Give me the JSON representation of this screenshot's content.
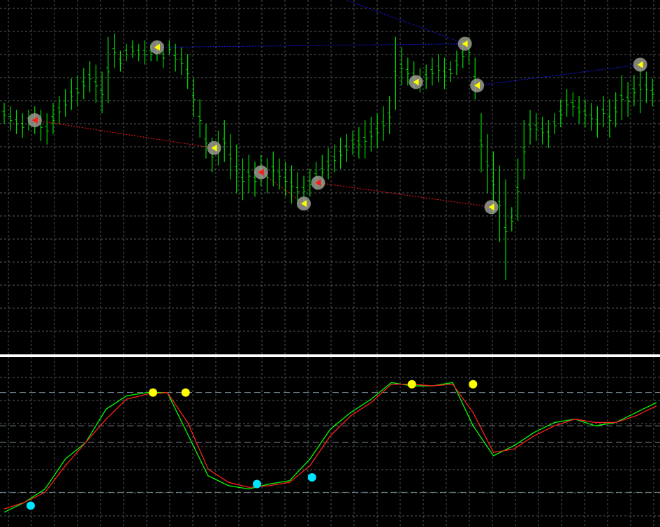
{
  "colors": {
    "background": "#000000",
    "grid": "#9aa3a3",
    "candle": "#00dd00",
    "upper_trend": "#1a1aff",
    "lower_trend": "#ff1a1a",
    "signal_marker": "#9a9a90",
    "osc_main": "#00ff00",
    "osc_signal": "#ff2020",
    "dot_top": "#ffff00",
    "dot_bottom": "#00e5ff",
    "level_line": "#7a8a95",
    "separator": "#ffffff"
  },
  "chart_data": [
    {
      "type": "ohlc",
      "panel": "price",
      "xlim": [
        0,
        320
      ],
      "ylim": [
        0,
        100
      ],
      "grid": true,
      "bars": [
        [
          0,
          72,
          66
        ],
        [
          3,
          71,
          64
        ],
        [
          6,
          70,
          63
        ],
        [
          9,
          69,
          62
        ],
        [
          12,
          70,
          64
        ],
        [
          15,
          71,
          63
        ],
        [
          18,
          70,
          61
        ],
        [
          21,
          69,
          60
        ],
        [
          24,
          72,
          63
        ],
        [
          27,
          74,
          66
        ],
        [
          30,
          76,
          68
        ],
        [
          33,
          79,
          70
        ],
        [
          36,
          80,
          71
        ],
        [
          39,
          82,
          73
        ],
        [
          42,
          84,
          75
        ],
        [
          45,
          83,
          72
        ],
        [
          48,
          81,
          69
        ],
        [
          51,
          91,
          72
        ],
        [
          54,
          92,
          82
        ],
        [
          57,
          87,
          81
        ],
        [
          60,
          89,
          84
        ],
        [
          63,
          90,
          85
        ],
        [
          66,
          89,
          84
        ],
        [
          69,
          90,
          83
        ],
        [
          72,
          89,
          84
        ],
        [
          75,
          90,
          84
        ],
        [
          78,
          89,
          82
        ],
        [
          81,
          90,
          86
        ],
        [
          84,
          89,
          81
        ],
        [
          87,
          88,
          80
        ],
        [
          90,
          86,
          76
        ],
        [
          93,
          79,
          68
        ],
        [
          96,
          73,
          62
        ],
        [
          99,
          66,
          56
        ],
        [
          102,
          62,
          52
        ],
        [
          105,
          64,
          54
        ],
        [
          108,
          67,
          55
        ],
        [
          111,
          63,
          50
        ],
        [
          114,
          60,
          46
        ],
        [
          117,
          56,
          44
        ],
        [
          120,
          57,
          46
        ],
        [
          123,
          55,
          45
        ],
        [
          126,
          57,
          48
        ],
        [
          129,
          56,
          46
        ],
        [
          132,
          58,
          48
        ],
        [
          135,
          56,
          47
        ],
        [
          138,
          55,
          45
        ],
        [
          141,
          54,
          43
        ],
        [
          144,
          52,
          42
        ],
        [
          147,
          51,
          43
        ],
        [
          150,
          53,
          45
        ],
        [
          153,
          55,
          47
        ],
        [
          156,
          57,
          48
        ],
        [
          159,
          59,
          50
        ],
        [
          162,
          60,
          52
        ],
        [
          165,
          62,
          53
        ],
        [
          168,
          63,
          55
        ],
        [
          171,
          64,
          57
        ],
        [
          174,
          65,
          56
        ],
        [
          177,
          67,
          56
        ],
        [
          180,
          68,
          58
        ],
        [
          183,
          69,
          59
        ],
        [
          186,
          71,
          61
        ],
        [
          189,
          74,
          63
        ],
        [
          192,
          91,
          70
        ],
        [
          195,
          88,
          77
        ],
        [
          198,
          85,
          77
        ],
        [
          201,
          84,
          76
        ],
        [
          204,
          82,
          75
        ],
        [
          207,
          83,
          76
        ],
        [
          210,
          85,
          77
        ],
        [
          213,
          86,
          78
        ],
        [
          216,
          85,
          76
        ],
        [
          219,
          84,
          78
        ],
        [
          222,
          87,
          80
        ],
        [
          225,
          90,
          82
        ],
        [
          228,
          91,
          83
        ],
        [
          231,
          85,
          73
        ],
        [
          234,
          69,
          52
        ],
        [
          237,
          63,
          46
        ],
        [
          240,
          58,
          40
        ],
        [
          243,
          54,
          32
        ],
        [
          246,
          50,
          21
        ],
        [
          249,
          42,
          35
        ],
        [
          252,
          56,
          38
        ],
        [
          255,
          67,
          50
        ],
        [
          258,
          70,
          60
        ],
        [
          261,
          69,
          61
        ],
        [
          264,
          68,
          60
        ],
        [
          267,
          67,
          59
        ],
        [
          270,
          69,
          63
        ],
        [
          273,
          73,
          65
        ],
        [
          276,
          76,
          68
        ],
        [
          279,
          75,
          68
        ],
        [
          282,
          74,
          66
        ],
        [
          285,
          73,
          65
        ],
        [
          288,
          72,
          64
        ],
        [
          291,
          71,
          62
        ],
        [
          294,
          74,
          65
        ],
        [
          297,
          73,
          62
        ],
        [
          300,
          75,
          65
        ],
        [
          303,
          80,
          67
        ],
        [
          306,
          78,
          68
        ],
        [
          309,
          80,
          71
        ],
        [
          312,
          84,
          69
        ],
        [
          315,
          81,
          72
        ],
        [
          318,
          79,
          71
        ]
      ],
      "signal_markers": [
        {
          "x": 15,
          "y": 67,
          "kind": "buy"
        },
        {
          "x": 75,
          "y": 88,
          "kind": "sell"
        },
        {
          "x": 103,
          "y": 59,
          "kind": "sell"
        },
        {
          "x": 126,
          "y": 52,
          "kind": "buy"
        },
        {
          "x": 147,
          "y": 43,
          "kind": "sell"
        },
        {
          "x": 154,
          "y": 49,
          "kind": "buy"
        },
        {
          "x": 202,
          "y": 78,
          "kind": "sell"
        },
        {
          "x": 226,
          "y": 89,
          "kind": "sell"
        },
        {
          "x": 232,
          "y": 77,
          "kind": "sell"
        },
        {
          "x": 239,
          "y": 42,
          "kind": "sell"
        },
        {
          "x": 312,
          "y": 83,
          "kind": "sell"
        }
      ],
      "trend_lines": [
        {
          "color": "upper",
          "points": [
            [
              0,
              138
            ],
            [
              226,
              89
            ]
          ]
        },
        {
          "color": "upper",
          "points": [
            [
              75,
              88
            ],
            [
              226,
              89
            ]
          ]
        },
        {
          "color": "upper",
          "points": [
            [
              232,
              77
            ],
            [
              312,
              83
            ]
          ]
        },
        {
          "color": "lower",
          "points": [
            [
              15,
              67
            ],
            [
              103,
              59
            ]
          ]
        },
        {
          "color": "lower",
          "points": [
            [
              126,
              52
            ],
            [
              147,
              43
            ]
          ]
        },
        {
          "color": "lower",
          "points": [
            [
              154,
              49
            ],
            [
              239,
              42
            ]
          ]
        }
      ]
    },
    {
      "type": "line",
      "panel": "oscillator",
      "xlim": [
        0,
        320
      ],
      "ylim": [
        0,
        100
      ],
      "levels": [
        80,
        60,
        50,
        20
      ],
      "grid": true,
      "series": [
        {
          "role": "main",
          "x": [
            0,
            10,
            20,
            30,
            40,
            50,
            60,
            70,
            80,
            90,
            100,
            110,
            120,
            130,
            140,
            150,
            160,
            170,
            180,
            190,
            200,
            210,
            220,
            230,
            240,
            250,
            260,
            270,
            280,
            290,
            300,
            310,
            320
          ],
          "values": [
            8,
            14,
            22,
            40,
            50,
            70,
            78,
            80,
            80,
            55,
            30,
            24,
            22,
            25,
            27,
            40,
            58,
            68,
            76,
            86,
            84,
            84,
            86,
            60,
            42,
            48,
            56,
            62,
            64,
            60,
            62,
            68,
            74
          ]
        },
        {
          "role": "signal",
          "x": [
            0,
            10,
            20,
            30,
            40,
            50,
            60,
            70,
            80,
            90,
            100,
            110,
            120,
            130,
            140,
            150,
            160,
            170,
            180,
            190,
            200,
            210,
            220,
            230,
            240,
            250,
            260,
            270,
            280,
            290,
            300,
            310,
            320
          ],
          "values": [
            10,
            14,
            20,
            36,
            50,
            64,
            76,
            79,
            80,
            62,
            34,
            26,
            23,
            24,
            26,
            36,
            54,
            66,
            74,
            85,
            85,
            84,
            85,
            68,
            44,
            46,
            54,
            60,
            64,
            62,
            62,
            66,
            72
          ]
        }
      ],
      "markers": [
        {
          "x": 13,
          "y": 12,
          "kind": "bottom"
        },
        {
          "x": 73,
          "y": 80,
          "kind": "top"
        },
        {
          "x": 89,
          "y": 80,
          "kind": "top"
        },
        {
          "x": 124,
          "y": 25,
          "kind": "bottom"
        },
        {
          "x": 151,
          "y": 29,
          "kind": "bottom"
        },
        {
          "x": 200,
          "y": 85,
          "kind": "top"
        },
        {
          "x": 230,
          "y": 85,
          "kind": "top"
        }
      ]
    }
  ]
}
